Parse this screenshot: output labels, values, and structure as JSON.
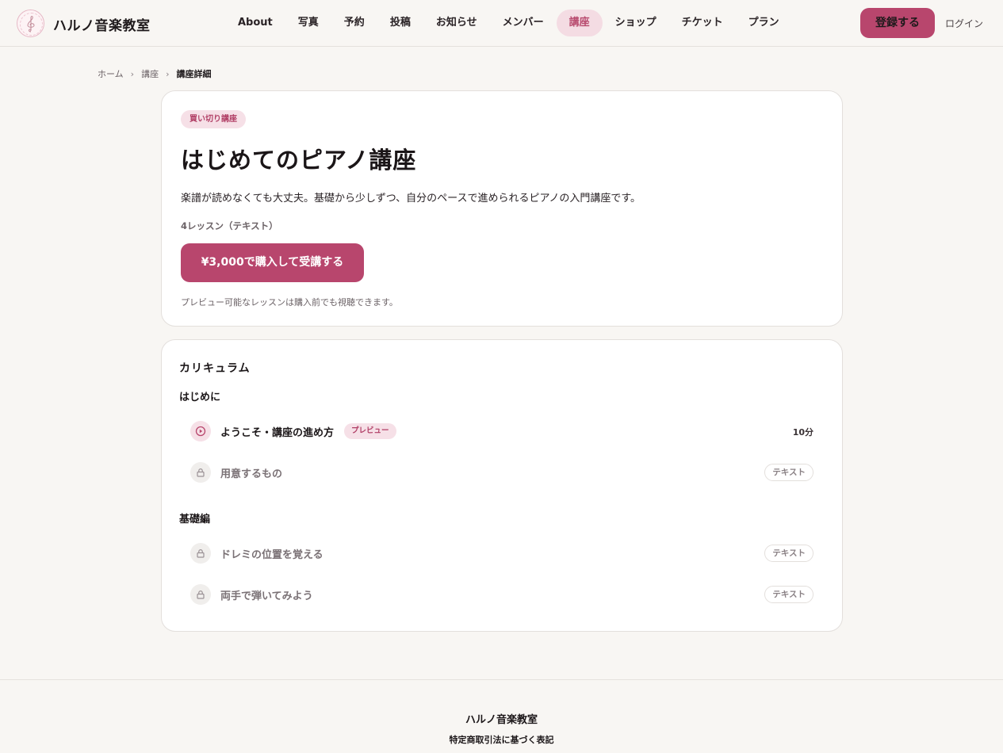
{
  "brand": {
    "name": "ハルノ音楽教室",
    "logo_icon": "treble-clef-icon"
  },
  "nav": {
    "items": [
      {
        "label": "About",
        "active": false
      },
      {
        "label": "写真",
        "active": false
      },
      {
        "label": "予約",
        "active": false
      },
      {
        "label": "投稿",
        "active": false
      },
      {
        "label": "お知らせ",
        "active": false
      },
      {
        "label": "メンバー",
        "active": false
      },
      {
        "label": "講座",
        "active": true
      },
      {
        "label": "ショップ",
        "active": false
      },
      {
        "label": "チケット",
        "active": false
      },
      {
        "label": "プラン",
        "active": false
      }
    ],
    "register_label": "登録する",
    "login_label": "ログイン"
  },
  "breadcrumb": {
    "items": [
      "ホーム",
      "講座",
      "講座詳細"
    ],
    "separator": "›"
  },
  "course": {
    "type_badge": "買い切り講座",
    "title": "はじめてのピアノ講座",
    "description": "楽譜が読めなくても大丈夫。基礎から少しずつ、自分のペースで進められるピアノの入門講座です。",
    "lesson_count": "4レッスン（テキスト）",
    "buy_label": "¥3,000で購入して受講する",
    "preview_note": "プレビュー可能なレッスンは購入前でも視聴できます。"
  },
  "curriculum": {
    "heading": "カリキュラム",
    "sections": [
      {
        "title": "はじめに",
        "lessons": [
          {
            "title": "ようこそ・講座の進め方",
            "icon": "play-icon",
            "badge": "プレビュー",
            "meta": "10分",
            "locked": false
          },
          {
            "title": "用意するもの",
            "icon": "lock-icon",
            "badge": "",
            "meta": "テキスト",
            "locked": true
          }
        ]
      },
      {
        "title": "基礎編",
        "lessons": [
          {
            "title": "ドレミの位置を覚える",
            "icon": "lock-icon",
            "badge": "",
            "meta": "テキスト",
            "locked": true
          },
          {
            "title": "両手で弾いてみよう",
            "icon": "lock-icon",
            "badge": "",
            "meta": "テキスト",
            "locked": true
          }
        ]
      }
    ]
  },
  "footer": {
    "name": "ハルノ音楽教室",
    "legal_link": "特定商取引法に基づく表記"
  },
  "colors": {
    "accent": "#b8466d",
    "accent_light": "#f6e0e7",
    "background": "#f8f6f3"
  }
}
